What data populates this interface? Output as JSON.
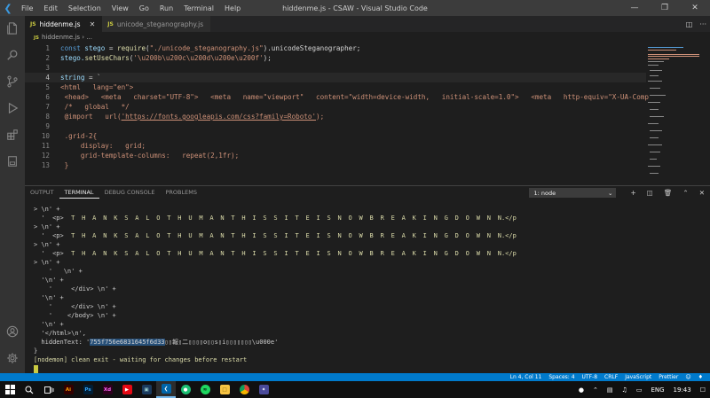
{
  "window": {
    "title": "hiddenme.js - CSAW - Visual Studio Code",
    "menu": [
      "File",
      "Edit",
      "Selection",
      "View",
      "Go",
      "Run",
      "Terminal",
      "Help"
    ]
  },
  "tabs": [
    {
      "label": "hiddenme.js",
      "active": true
    },
    {
      "label": "unicode_steganography.js",
      "active": false
    }
  ],
  "breadcrumb": "hiddenme.js",
  "editor": {
    "lines": [
      {
        "n": "1"
      },
      {
        "n": "2"
      },
      {
        "n": "3"
      },
      {
        "n": "4"
      },
      {
        "n": "5"
      },
      {
        "n": "6"
      },
      {
        "n": "7"
      },
      {
        "n": "8"
      },
      {
        "n": "9"
      },
      {
        "n": "10"
      },
      {
        "n": "11"
      },
      {
        "n": "12"
      },
      {
        "n": "13"
      }
    ],
    "code": {
      "l1_a": "const",
      "l1_b": " stego ",
      "l1_c": "= ",
      "l1_d": "require",
      "l1_e": "(",
      "l1_f": "\"./unicode_steganography.js\"",
      "l1_g": ").unicodeSteganographer;",
      "l2_a": "stego.",
      "l2_b": "setUseChars",
      "l2_c": "(",
      "l2_d": "'\\u200b\\u200c\\u200d\\u200e\\u200f'",
      "l2_e": ");",
      "l4_a": "string",
      "l4_b": " = `",
      "l5": "<html   lang=\"en\">",
      "l6": " <head>   <meta   charset=\"UTF-8\">   <meta   name=\"viewport\"   content=\"width=device-width,   initial-scale=1.0\">   <meta   http-equiv=\"X-UA-Comp",
      "l7": " /*   global   */",
      "l8_a": " @import   url(",
      "l8_b": "'https://fonts.googleapis.com/css?family=Roboto'",
      "l8_c": ");",
      "l10": " .grid-2{",
      "l11": "     display:   grid;",
      "l12": "     grid-template-columns:   repeat(2,1fr);",
      "l13": " }"
    }
  },
  "panel": {
    "tabs": [
      "OUTPUT",
      "TERMINAL",
      "DEBUG CONSOLE",
      "PROBLEMS"
    ],
    "active_tab": "TERMINAL",
    "terminal_select": "1: node",
    "lines": {
      "t1": "> \\n' +",
      "t2_a": "  '  <p>  ",
      "t2_b": "THANKSALOTHUMANTHISSITEISNOWBREAKINGDOWN",
      "t2_c": "N.</p",
      "t3": "> \\n' +",
      "t4_a": "  '  <p>  ",
      "t4_b": "THANKSALOTHUMANTHISSITEISNOWBREAKINGDOWN",
      "t4_c": "N.</p",
      "t5": "> \\n' +",
      "t6_a": "  '  <p>  ",
      "t6_b": "THANKSALOTHUMANTHISSITEISNOWBREAKINGDOWN",
      "t6_c": "N.</p",
      "t7": "> \\n' +",
      "t8": "    '   \\n' +",
      "t9": "  '\\n' +",
      "t10": "    '     </div> \\n' +",
      "t11": "  '\\n' +",
      "t12": "    '     </div> \\n' +",
      "t13": "    '    </body> \\n' +",
      "t14": "  '\\n' +",
      "t15": "  '</html>\\n',",
      "t16_a": "  hiddenText: '",
      "t16_b": "755f756e6831645f6d33",
      "t16_c": "▯▯報▯二▯▯▯▯o▯▯s▯i▯▯▯▯▯▯▯\\u000e'",
      "t17": "}",
      "t18": "[nodemon] clean exit - waiting for changes before restart"
    }
  },
  "statusbar": [
    "Ln 4, Col 11",
    "Spaces: 4",
    "UTF-8",
    "CRLF",
    "JavaScript",
    "Prettier"
  ],
  "taskbar": {
    "lang": "ENG",
    "time": "19:43"
  }
}
